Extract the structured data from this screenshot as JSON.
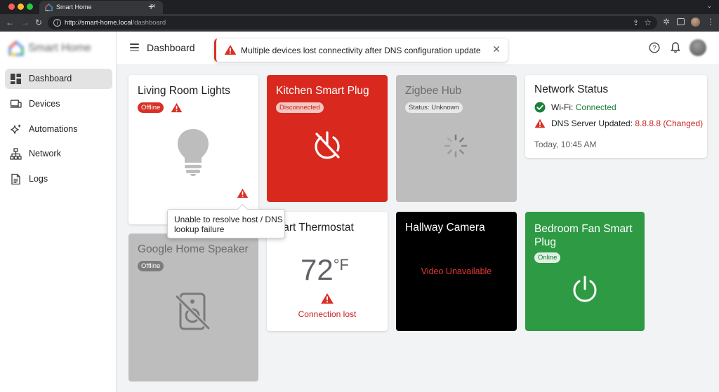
{
  "browser": {
    "tab_title": "Smart Home",
    "new_tab_label": "+",
    "url_host": "http://smart-home.local",
    "url_path": "/dashboard",
    "icons": [
      "back-icon",
      "forward-icon",
      "reload-icon",
      "info-icon",
      "share-icon",
      "star-icon",
      "extensions-icon",
      "sidebar-icon",
      "profile-avatar",
      "menu-icon"
    ]
  },
  "app": {
    "brand_name": "Smart Home",
    "page_title": "Dashboard",
    "colors": {
      "danger": "#d93025",
      "success": "#188038",
      "card_red": "#d9291f",
      "card_green": "#2e9b44",
      "card_grey": "#bdbdbd"
    }
  },
  "sidebar": {
    "items": [
      {
        "label": "Dashboard",
        "icon": "dashboard-icon",
        "active": true
      },
      {
        "label": "Devices",
        "icon": "devices-icon",
        "active": false
      },
      {
        "label": "Automations",
        "icon": "sparkle-icon",
        "active": false
      },
      {
        "label": "Network",
        "icon": "network-icon",
        "active": false
      },
      {
        "label": "Logs",
        "icon": "document-icon",
        "active": false
      }
    ]
  },
  "toast": {
    "message": "Multiple devices lost connectivity after DNS configuration update",
    "close_label": "✕"
  },
  "cards": {
    "living_room": {
      "title": "Living Room Lights",
      "status": "Offline",
      "tooltip": "Unable to resolve host / DNS lookup failure"
    },
    "kitchen": {
      "title": "Kitchen Smart Plug",
      "status": "Disconnected"
    },
    "zigbee": {
      "title": "Zigbee Hub",
      "status": "Status: Unknown"
    },
    "network": {
      "title": "Network Status",
      "wifi_label": "Wi-Fi: ",
      "wifi_value": "Connected",
      "dns_label": "DNS Server Updated: ",
      "dns_value": "8.8.8.8 (Changed)",
      "timestamp": "Today, 10:45 AM"
    },
    "speaker": {
      "title": "Google Home Speaker",
      "status": "Offline"
    },
    "thermostat": {
      "title": "Smart Thermostat",
      "temperature": "72",
      "unit": "°F",
      "message": "Connection lost"
    },
    "camera": {
      "title": "Hallway Camera",
      "message": "Video Unavailable"
    },
    "fan": {
      "title": "Bedroom Fan Smart Plug",
      "status": "Online"
    }
  }
}
